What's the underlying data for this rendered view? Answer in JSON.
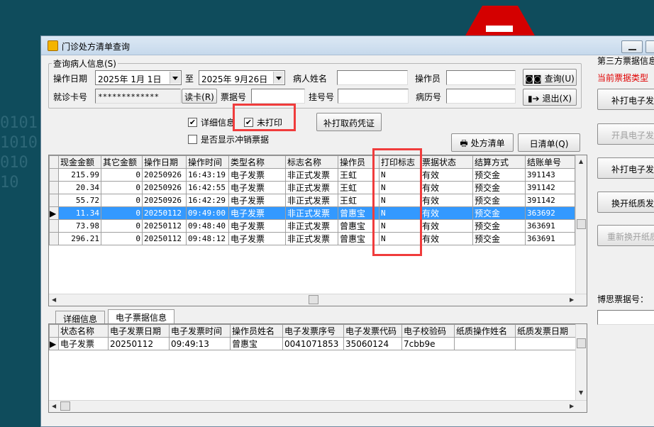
{
  "window": {
    "title": "门诊处方清单查询"
  },
  "query": {
    "group_label": "查询病人信息(S)",
    "op_date_label": "操作日期",
    "date_from": "2025年  1月  1日",
    "to_label": "至",
    "date_to": "2025年  9月26日",
    "patient_name_label": "病人姓名",
    "patient_name": "",
    "operator_label": "操作员",
    "operator": "",
    "query_btn": "查询(U)",
    "card_no_label": "就诊卡号",
    "card_no": "*************",
    "read_card_btn": "读卡(R)",
    "bill_no_label": "票据号",
    "bill_no": "",
    "reg_no_label": "挂号号",
    "reg_no": "",
    "record_no_label": "病历号",
    "record_no": "",
    "exit_btn": "退出(X)"
  },
  "options": {
    "detail_info": {
      "label": "详细信息",
      "checked": true
    },
    "unprinted": {
      "label": "未打印",
      "checked": true
    },
    "show_reversed": {
      "label": "是否显示冲销票据",
      "checked": false
    },
    "reprint_btn": "补打取药凭证",
    "prescription_btn": "处方清单",
    "daily_btn": "日清单(Q)"
  },
  "main_grid": {
    "columns": [
      "现金金额",
      "其它金额",
      "操作日期",
      "操作时间",
      "类型名称",
      "标志名称",
      "操作员",
      "打印标志",
      "票据状态",
      "结算方式",
      "结账单号"
    ],
    "rows": [
      [
        "215.99",
        "0",
        "20250926",
        "16:43:19",
        "电子发票",
        "非正式发票",
        "王虹",
        "N",
        "有效",
        "预交金",
        "391143"
      ],
      [
        "20.34",
        "0",
        "20250926",
        "16:42:55",
        "电子发票",
        "非正式发票",
        "王虹",
        "N",
        "有效",
        "预交金",
        "391142"
      ],
      [
        "55.72",
        "0",
        "20250926",
        "16:42:29",
        "电子发票",
        "非正式发票",
        "王虹",
        "N",
        "有效",
        "预交金",
        "391142"
      ],
      [
        "11.34",
        "0",
        "20250112",
        "09:49:00",
        "电子发票",
        "非正式发票",
        "曾惠宝",
        "N",
        "有效",
        "预交金",
        "363692"
      ],
      [
        "73.98",
        "0",
        "20250112",
        "09:48:40",
        "电子发票",
        "非正式发票",
        "曾惠宝",
        "N",
        "有效",
        "预交金",
        "363691"
      ],
      [
        "296.21",
        "0",
        "20250112",
        "09:48:12",
        "电子发票",
        "非正式发票",
        "曾惠宝",
        "N",
        "有效",
        "预交金",
        "363691"
      ]
    ],
    "selected_row": 3
  },
  "tabs": [
    "详细信息",
    "电子票据信息"
  ],
  "active_tab": 1,
  "detail_grid": {
    "columns": [
      "状态名称",
      "电子发票日期",
      "电子发票时间",
      "操作员姓名",
      "电子发票序号",
      "电子发票代码",
      "电子校验码",
      "纸质操作姓名",
      "纸质发票日期"
    ],
    "rows": [
      [
        "电子发票",
        "20250112",
        "09:49:13",
        "曾惠宝",
        "0041071853",
        "35060124",
        "7cbb9e",
        "",
        ""
      ]
    ]
  },
  "right_panel": {
    "title": "第三方票据信息",
    "current_type": "当前票据类型",
    "btn_reprint_e": "补打电子发",
    "btn_issue_e": "开具电子发",
    "btn_reprint_e2": "补打电子发",
    "btn_paper": "换开纸质发",
    "btn_reissue_paper": "重新换开纸质",
    "bosi_label": "博思票据号："
  },
  "accent_color": "#f03c3c"
}
